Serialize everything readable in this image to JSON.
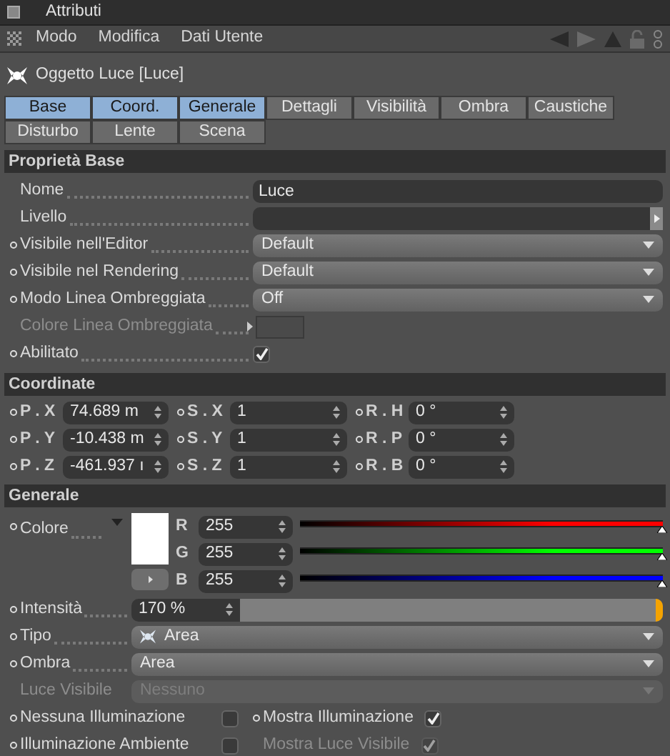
{
  "window": {
    "title": "Attributi"
  },
  "menu": [
    {
      "label": "Modo"
    },
    {
      "label": "Modifica"
    },
    {
      "label": "Dati Utente"
    }
  ],
  "object_title": "Oggetto Luce [Luce]",
  "tab_rows": [
    [
      {
        "label": "Base",
        "selected": true
      },
      {
        "label": "Coord.",
        "selected": true
      },
      {
        "label": "Generale",
        "selected": true
      },
      {
        "label": "Dettagli",
        "selected": false
      },
      {
        "label": "Visibilità",
        "selected": false
      },
      {
        "label": "Ombra",
        "selected": false
      },
      {
        "label": "Caustiche",
        "selected": false
      }
    ],
    [
      {
        "label": "Disturbo",
        "selected": false
      },
      {
        "label": "Lente",
        "selected": false
      },
      {
        "label": "Scena",
        "selected": false
      }
    ]
  ],
  "base": {
    "title": "Proprietà Base",
    "rows": [
      {
        "kind": "text",
        "label": "Nome",
        "value": "Luce",
        "keyframe_dot": false,
        "disabled": false
      },
      {
        "kind": "link",
        "label": "Livello",
        "keyframe_dot": false,
        "disabled": false
      },
      {
        "kind": "dropdown",
        "label": "Visibile nell'Editor",
        "value": "Default",
        "keyframe_dot": true,
        "disabled": false
      },
      {
        "kind": "dropdown",
        "label": "Visibile nel Rendering",
        "value": "Default",
        "keyframe_dot": true,
        "disabled": false
      },
      {
        "kind": "dropdown",
        "label": "Modo Linea Ombreggiata",
        "value": "Off",
        "keyframe_dot": true,
        "disabled": false
      },
      {
        "kind": "swatch",
        "label": "Colore Linea Ombreggiata",
        "keyframe_dot": false,
        "disabled": true
      },
      {
        "kind": "checkbox",
        "label": "Abilitato",
        "checked": true,
        "keyframe_dot": true,
        "disabled": false
      }
    ]
  },
  "coordinates": {
    "title": "Coordinate",
    "rows": [
      [
        {
          "label": "P . X",
          "value": "74.689 m"
        },
        {
          "label": "S . X",
          "value": "1"
        },
        {
          "label": "R . H",
          "value": "0 °"
        }
      ],
      [
        {
          "label": "P . Y",
          "value": "-10.438 m"
        },
        {
          "label": "S . Y",
          "value": "1"
        },
        {
          "label": "R . P",
          "value": "0 °"
        }
      ],
      [
        {
          "label": "P . Z",
          "value": "-461.937 ı"
        },
        {
          "label": "S . Z",
          "value": "1"
        },
        {
          "label": "R . B",
          "value": "0 °"
        }
      ]
    ]
  },
  "general": {
    "title": "Generale",
    "color": {
      "label": "Colore",
      "channels": [
        {
          "label": "R",
          "value": "255",
          "level": 1,
          "color": "#ff0000"
        },
        {
          "label": "G",
          "value": "255",
          "level": 1,
          "color": "#00ff00"
        },
        {
          "label": "B",
          "value": "255",
          "level": 1,
          "color": "#0000ff"
        }
      ]
    },
    "intensity": {
      "label": "Intensità",
      "value": "170 %",
      "level": 1
    },
    "rows": [
      {
        "kind": "dropdown_icon",
        "label": "Tipo",
        "value": "Area",
        "keyframe_dot": true,
        "disabled": false
      },
      {
        "kind": "dropdown",
        "label": "Ombra",
        "value": "Area",
        "keyframe_dot": true,
        "disabled": false
      },
      {
        "kind": "dropdown",
        "label": "Luce Visibile",
        "value": "Nessuno",
        "keyframe_dot": false,
        "disabled": true
      }
    ],
    "checkboxes": [
      {
        "label": "Nessuna Illuminazione",
        "checked": false,
        "keyframe_dot": true,
        "disabled": false
      },
      {
        "label": "Mostra Illuminazione",
        "checked": true,
        "keyframe_dot": true,
        "disabled": false
      },
      {
        "label": "Illuminazione Ambiente",
        "checked": false,
        "keyframe_dot": true,
        "disabled": false
      },
      {
        "label": "Mostra Luce Visibile",
        "checked": true,
        "keyframe_dot": false,
        "disabled": true
      }
    ]
  }
}
